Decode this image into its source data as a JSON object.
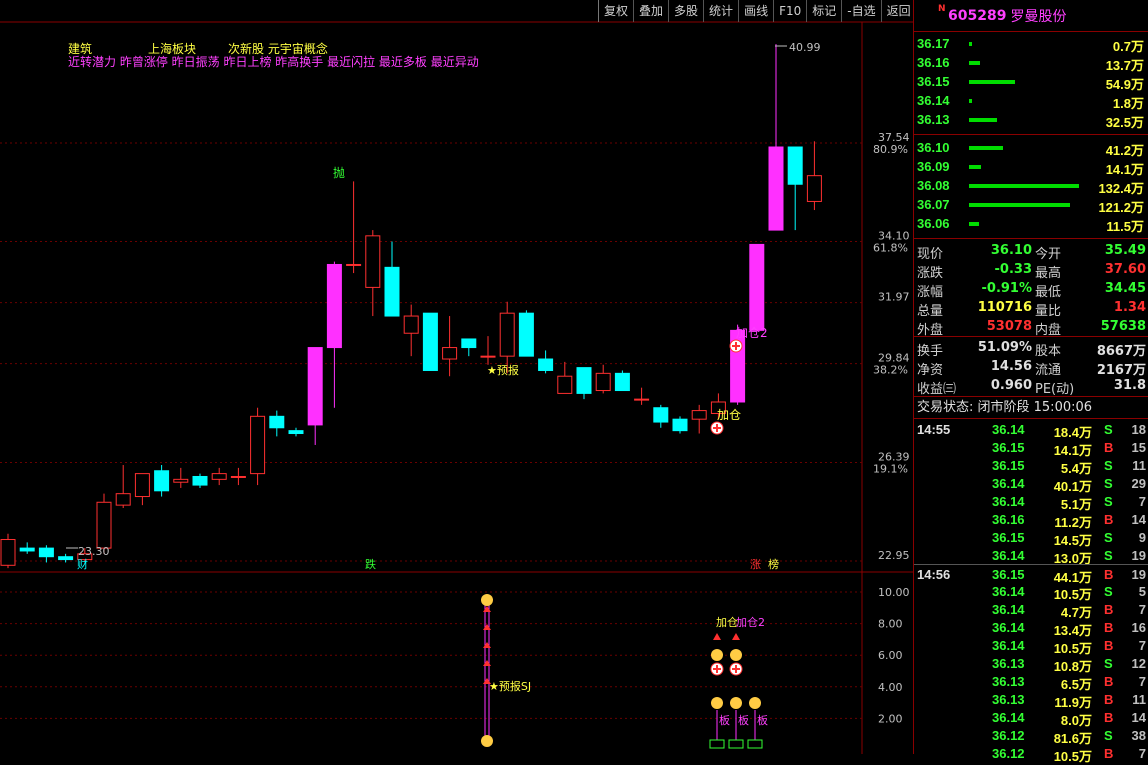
{
  "toolbar": [
    "复权",
    "叠加",
    "多股",
    "统计",
    "画线",
    "F10",
    "标记",
    "-自选",
    "返回"
  ],
  "stock": {
    "code": "605289",
    "name": "罗曼股份",
    "mark": "N"
  },
  "chart_texts": {
    "line1": [
      "建筑",
      "上海板块",
      "次新股 元宇宙概念"
    ],
    "line2": "近转潜力 昨曾涨停 昨日振荡 昨日上榜 昨高换手 最近闪拉 最近多板 最近异动",
    "high_label": "40.99",
    "low_label": "23.30",
    "pao": "抛",
    "jiacang2": "加仓2",
    "jiacang": "加仓",
    "yubao": "★预报",
    "yubaosj": "★预报SJ",
    "cai": "财",
    "die": "跌",
    "zhang": "涨",
    "bang": "榜",
    "ban": "板"
  },
  "price_axis": [
    {
      "price": "37.54",
      "pct": "80.9%"
    },
    {
      "price": "34.10",
      "pct": "61.8%"
    },
    {
      "price": "31.97",
      "pct": ""
    },
    {
      "price": "29.84",
      "pct": "38.2%"
    },
    {
      "price": "26.39",
      "pct": "19.1%"
    },
    {
      "price": "22.95",
      "pct": ""
    }
  ],
  "ind_axis": [
    "10.00",
    "8.00",
    "6.00",
    "4.00",
    "2.00"
  ],
  "candles": [
    [
      22.8,
      23.7,
      22.7,
      23.9
    ],
    [
      23.4,
      23.3,
      23.2,
      23.6
    ],
    [
      23.4,
      23.1,
      22.9,
      23.5
    ],
    [
      23.1,
      23.0,
      22.9,
      23.2
    ],
    [
      23.0,
      23.2,
      22.9,
      23.4
    ],
    [
      23.4,
      25.0,
      23.2,
      25.3
    ],
    [
      24.9,
      25.3,
      24.8,
      26.3
    ],
    [
      25.2,
      26.0,
      24.9,
      26.0
    ],
    [
      26.1,
      25.4,
      25.2,
      26.3
    ],
    [
      25.7,
      25.8,
      25.5,
      26.2
    ],
    [
      25.9,
      25.6,
      25.5,
      26.0
    ],
    [
      25.8,
      26.0,
      25.6,
      26.2
    ],
    [
      25.9,
      25.9,
      25.6,
      26.2
    ],
    [
      26.0,
      28.0,
      25.6,
      28.3
    ],
    [
      28.0,
      27.6,
      27.3,
      28.2
    ],
    [
      27.5,
      27.4,
      27.3,
      27.6
    ],
    [
      27.7,
      30.4,
      27.0,
      30.4
    ],
    [
      30.4,
      33.3,
      28.3,
      33.4
    ],
    [
      33.3,
      33.3,
      33.0,
      36.2
    ],
    [
      32.5,
      34.3,
      31.5,
      34.5
    ],
    [
      33.2,
      31.5,
      31.5,
      34.1
    ],
    [
      30.9,
      31.5,
      30.1,
      31.9
    ],
    [
      31.6,
      29.6,
      29.6,
      31.6
    ],
    [
      30.0,
      30.4,
      29.4,
      31.5
    ],
    [
      30.7,
      30.4,
      30.1,
      30.7
    ],
    [
      30.1,
      30.1,
      29.8,
      30.8
    ],
    [
      30.1,
      31.6,
      29.5,
      32.0
    ],
    [
      31.6,
      30.1,
      30.1,
      31.7
    ],
    [
      30.0,
      29.6,
      29.5,
      30.3
    ],
    [
      28.8,
      29.4,
      28.8,
      29.9
    ],
    [
      29.7,
      28.8,
      28.6,
      29.7
    ],
    [
      28.9,
      29.5,
      28.8,
      29.8
    ],
    [
      29.5,
      28.9,
      28.9,
      29.6
    ],
    [
      28.6,
      28.6,
      28.4,
      29.0
    ],
    [
      28.3,
      27.8,
      27.6,
      28.4
    ],
    [
      27.9,
      27.5,
      27.4,
      28.0
    ],
    [
      27.9,
      28.2,
      27.4,
      28.4
    ],
    [
      28.1,
      28.5,
      27.9,
      28.8
    ],
    [
      28.5,
      31.0,
      28.4,
      31.2
    ],
    [
      31.0,
      34.0,
      31.0,
      34.0
    ],
    [
      37.4,
      34.5,
      34.5,
      40.99
    ],
    [
      37.4,
      36.1,
      34.5,
      37.4
    ],
    [
      35.5,
      36.4,
      35.2,
      37.6
    ]
  ],
  "order_book": {
    "asks": [
      {
        "price": "36.17",
        "vol": "0.7万",
        "w": 0.02
      },
      {
        "price": "36.16",
        "vol": "13.7万",
        "w": 0.1
      },
      {
        "price": "36.15",
        "vol": "54.9万",
        "w": 0.42
      },
      {
        "price": "36.14",
        "vol": "1.8万",
        "w": 0.02
      },
      {
        "price": "36.13",
        "vol": "32.5万",
        "w": 0.25
      }
    ],
    "bids": [
      {
        "price": "36.10",
        "vol": "41.2万",
        "w": 0.31
      },
      {
        "price": "36.09",
        "vol": "14.1万",
        "w": 0.11
      },
      {
        "price": "36.08",
        "vol": "132.4万",
        "w": 1.0
      },
      {
        "price": "36.07",
        "vol": "121.2万",
        "w": 0.92
      },
      {
        "price": "36.06",
        "vol": "11.5万",
        "w": 0.09
      }
    ]
  },
  "quote": [
    {
      "l1": "现价",
      "v1": "36.10",
      "c1": "grn",
      "l2": "今开",
      "v2": "35.49",
      "c2": "grn"
    },
    {
      "l1": "涨跌",
      "v1": "-0.33",
      "c1": "grn",
      "l2": "最高",
      "v2": "37.60",
      "c2": "red"
    },
    {
      "l1": "涨幅",
      "v1": "-0.91%",
      "c1": "grn",
      "l2": "最低",
      "v2": "34.45",
      "c2": "grn"
    },
    {
      "l1": "总量",
      "v1": "110716",
      "c1": "yel",
      "l2": "量比",
      "v2": "1.34",
      "c2": "red"
    },
    {
      "l1": "外盘",
      "v1": "53078",
      "c1": "red",
      "l2": "内盘",
      "v2": "57638",
      "c2": "grn"
    }
  ],
  "quote2": [
    {
      "l1": "换手",
      "v1": "51.09%",
      "c1": "wht",
      "l2": "股本",
      "v2": "8667万",
      "c2": "wht"
    },
    {
      "l1": "净资",
      "v1": "14.56",
      "c1": "wht",
      "l2": "流通",
      "v2": "2167万",
      "c2": "wht"
    },
    {
      "l1": "收益㈢",
      "v1": "0.960",
      "c1": "wht",
      "l2": "PE(动)",
      "v2": "31.8",
      "c2": "wht"
    }
  ],
  "trade_state": "交易状态: 闭市阶段 15:00:06",
  "trades": [
    {
      "t": "14:55",
      "p": "36.14",
      "v": "18.4万",
      "s": "S",
      "n": "18"
    },
    {
      "t": "",
      "p": "36.15",
      "v": "14.1万",
      "s": "B",
      "n": "15"
    },
    {
      "t": "",
      "p": "36.15",
      "v": "5.4万",
      "s": "S",
      "n": "11"
    },
    {
      "t": "",
      "p": "36.14",
      "v": "40.1万",
      "s": "S",
      "n": "29"
    },
    {
      "t": "",
      "p": "36.14",
      "v": "5.1万",
      "s": "S",
      "n": "7"
    },
    {
      "t": "",
      "p": "36.16",
      "v": "11.2万",
      "s": "B",
      "n": "14"
    },
    {
      "t": "",
      "p": "36.15",
      "v": "14.5万",
      "s": "S",
      "n": "9"
    },
    {
      "t": "",
      "p": "36.14",
      "v": "13.0万",
      "s": "S",
      "n": "19"
    },
    {
      "t": "14:56",
      "p": "36.15",
      "v": "44.1万",
      "s": "B",
      "n": "19"
    },
    {
      "t": "",
      "p": "36.14",
      "v": "10.5万",
      "s": "S",
      "n": "5"
    },
    {
      "t": "",
      "p": "36.14",
      "v": "4.7万",
      "s": "B",
      "n": "7"
    },
    {
      "t": "",
      "p": "36.14",
      "v": "13.4万",
      "s": "B",
      "n": "16"
    },
    {
      "t": "",
      "p": "36.14",
      "v": "10.5万",
      "s": "B",
      "n": "7"
    },
    {
      "t": "",
      "p": "36.13",
      "v": "10.8万",
      "s": "S",
      "n": "12"
    },
    {
      "t": "",
      "p": "36.13",
      "v": "6.5万",
      "s": "B",
      "n": "7"
    },
    {
      "t": "",
      "p": "36.13",
      "v": "11.9万",
      "s": "B",
      "n": "11"
    },
    {
      "t": "",
      "p": "36.14",
      "v": "8.0万",
      "s": "B",
      "n": "14"
    },
    {
      "t": "",
      "p": "36.12",
      "v": "81.6万",
      "s": "S",
      "n": "38"
    },
    {
      "t": "",
      "p": "36.12",
      "v": "10.5万",
      "s": "B",
      "n": "7"
    }
  ]
}
